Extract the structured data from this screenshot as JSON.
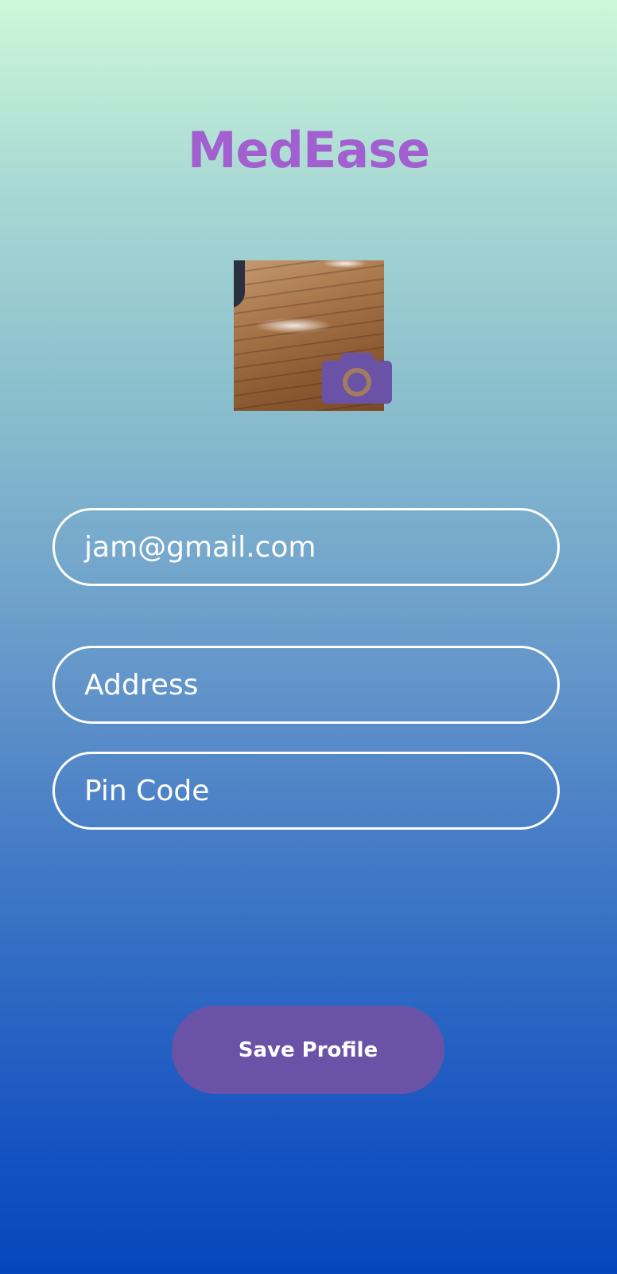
{
  "app": {
    "title": "MedEase",
    "title_color": "#a25fcf"
  },
  "profile": {
    "avatar_alt": "",
    "camera_icon": "camera-icon",
    "camera_color": "#6a52a6"
  },
  "form": {
    "email_value": "jam@gmail.com",
    "address_placeholder": "Address",
    "pin_placeholder": "Pin Code"
  },
  "actions": {
    "save_label": "Save Profile",
    "save_color": "#6a52a6"
  }
}
